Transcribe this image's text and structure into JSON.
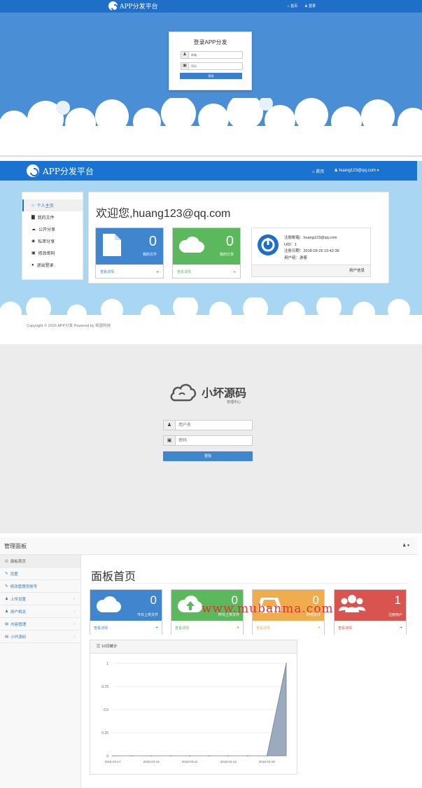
{
  "colors": {
    "brand_blue": "#1f6fc9",
    "blue": "#3f86cf",
    "green": "#5cb85c",
    "orange": "#f0ad4e",
    "red": "#d9534f"
  },
  "login1": {
    "brand": "APP分发平台",
    "nav": [
      "首页",
      "登录"
    ],
    "title": "登录APP分发",
    "username_ph": "邮箱",
    "password_ph": "密码",
    "button": "登录"
  },
  "user": {
    "brand": "APP分发平台",
    "nav_home": "首页",
    "nav_user": "huang123@qq.com",
    "sidebar": [
      {
        "label": "个人主页",
        "icon": "home-icon",
        "glyph": "⌂"
      },
      {
        "label": "我的文件",
        "icon": "file-icon",
        "glyph": "▇"
      },
      {
        "label": "公开分享",
        "icon": "cloud-icon",
        "glyph": "☁"
      },
      {
        "label": "私密分享",
        "icon": "eye-slash-icon",
        "glyph": "◉"
      },
      {
        "label": "修改密码",
        "icon": "lock-icon",
        "glyph": "▣"
      },
      {
        "label": "退出登录",
        "icon": "exit-icon",
        "glyph": "●"
      }
    ],
    "welcome": "欢迎您,huang123@qq.com",
    "stat_files": {
      "num": "0",
      "label": "我的文件",
      "link": "查看详情"
    },
    "stat_shares": {
      "num": "0",
      "label": "我的分享",
      "link": "查看详情"
    },
    "info": {
      "email": "注册邮箱：huang123@qq.com",
      "uid": "UID：1",
      "date": "注册日期：2018-03-26 15:42:38",
      "group": "用户组：游客"
    },
    "info_footer": "用户信息",
    "copyright": "Copyright © 2016 APP分发 Powered by 凯恩科技"
  },
  "login2": {
    "brand": "小坏源码",
    "sub": "管理中心",
    "username_ph": "用户名",
    "password_ph": "密码",
    "button": "登陆"
  },
  "admin": {
    "header_title": "管理面板",
    "header_user": "▾",
    "sidebar": [
      {
        "label": "面板首页",
        "icon": "dashboard-icon",
        "glyph": "◎",
        "chev": ""
      },
      {
        "label": "设置",
        "icon": "wrench-icon",
        "glyph": "✎",
        "chev": ""
      },
      {
        "label": "修改管理员账号",
        "icon": "wrench-icon",
        "glyph": "✎",
        "chev": ""
      },
      {
        "label": "上传设置",
        "icon": "users-icon",
        "glyph": "♟",
        "chev": "‹"
      },
      {
        "label": "用户相关",
        "icon": "user-icon",
        "glyph": "♟",
        "chev": "‹"
      },
      {
        "label": "内容管理",
        "icon": "table-icon",
        "glyph": "▤",
        "chev": "‹"
      },
      {
        "label": "小坏源码",
        "icon": "table-icon",
        "glyph": "▤",
        "chev": "‹"
      }
    ],
    "page_title": "面板首页",
    "stats": [
      {
        "num": "0",
        "label": "今日上传文件",
        "link": "查看详情",
        "color": "#3f86cf",
        "icon": "cloud-icon"
      },
      {
        "num": "0",
        "label": "昨日上传文件",
        "link": "查看详情",
        "color": "#5cb85c",
        "icon": "cloud-upload-icon"
      },
      {
        "num": "0",
        "label": "昨存文件",
        "link": "查看详情",
        "color": "#f0ad4e",
        "icon": "inbox-icon"
      },
      {
        "num": "1",
        "label": "注册用户",
        "link": "查看详情",
        "color": "#d9534f",
        "icon": "users-icon"
      }
    ],
    "chart_title": "10日统计",
    "watermark": "www.mubanma.com"
  },
  "chart_data": {
    "type": "area",
    "title": "10日统计",
    "x": [
      "2018-03-17",
      "2018-03-18",
      "2018-03-19",
      "2018-03-20",
      "2018-03-21",
      "2018-03-22",
      "2018-03-23",
      "2018-03-24",
      "2018-03-25",
      "2018-03-26"
    ],
    "x_tick_labels": [
      "2018-03-17",
      "2018-03-19",
      "2018-03-21",
      "2018-03-23",
      "2018-03-25"
    ],
    "series": [
      {
        "values": [
          0,
          0,
          0,
          0,
          0,
          0,
          0,
          0,
          0,
          1
        ]
      }
    ],
    "yticks": [
      "0",
      "0.25",
      "0.5",
      "0.75",
      "1"
    ],
    "ylim": [
      0,
      1
    ],
    "grid": true
  }
}
